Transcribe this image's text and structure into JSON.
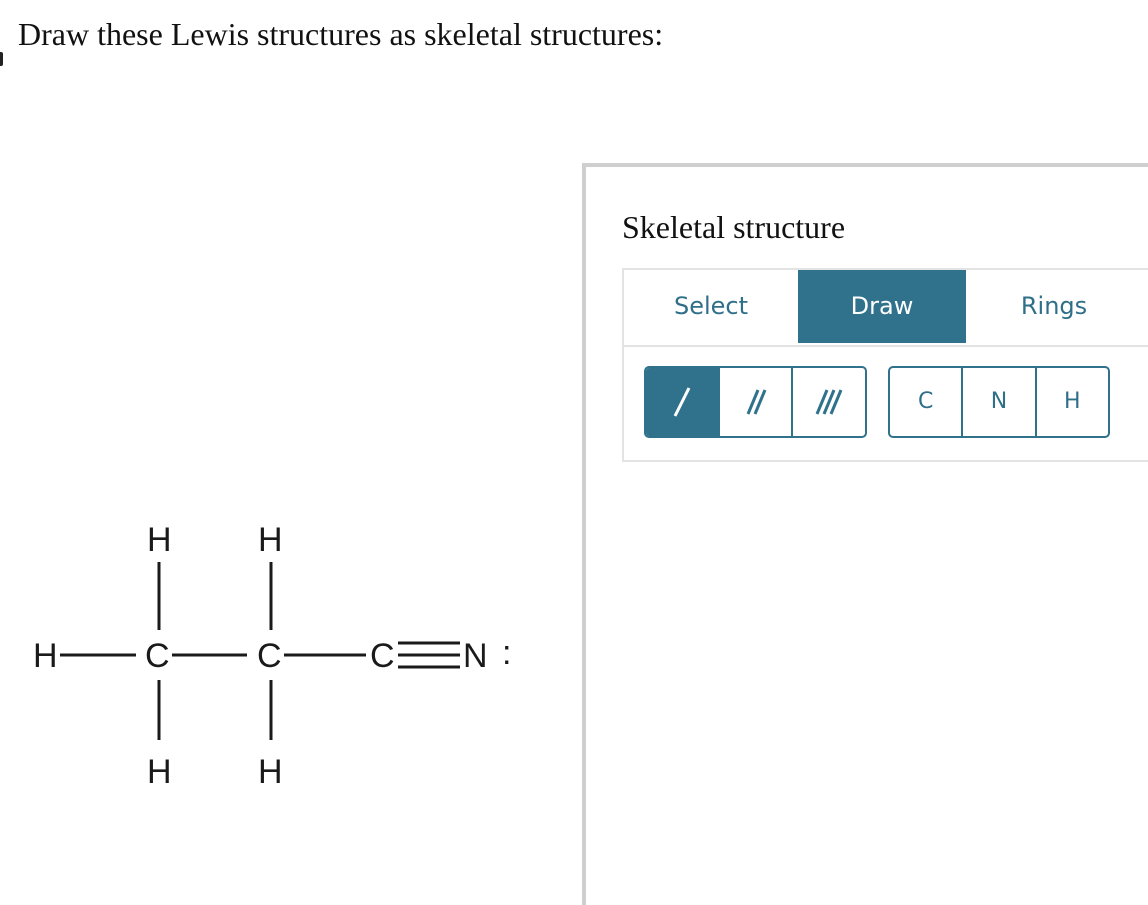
{
  "question": {
    "text": "Draw these Lewis structures as skeletal structures:"
  },
  "lewis_structure": {
    "atoms": {
      "h_left": "H",
      "c1": "C",
      "c2": "C",
      "c3": "C",
      "n": "N",
      "n_lone_pair": ":",
      "h_c1_top": "H",
      "h_c1_bottom": "H",
      "h_c2_top": "H",
      "h_c2_bottom": "H"
    }
  },
  "panel": {
    "title": "Skeletal structure",
    "tabs": [
      {
        "label": "Select",
        "active": false
      },
      {
        "label": "Draw",
        "active": true
      },
      {
        "label": "Rings",
        "active": false
      }
    ],
    "bond_tools": [
      {
        "name": "single-bond",
        "active": true
      },
      {
        "name": "double-bond",
        "active": false
      },
      {
        "name": "triple-bond",
        "active": false
      }
    ],
    "atom_tools": [
      {
        "label": "C"
      },
      {
        "label": "N"
      },
      {
        "label": "H"
      }
    ]
  },
  "colors": {
    "accent": "#30728c",
    "panel_border": "#cfcfcf",
    "toolbar_border": "#e3e3e3"
  }
}
